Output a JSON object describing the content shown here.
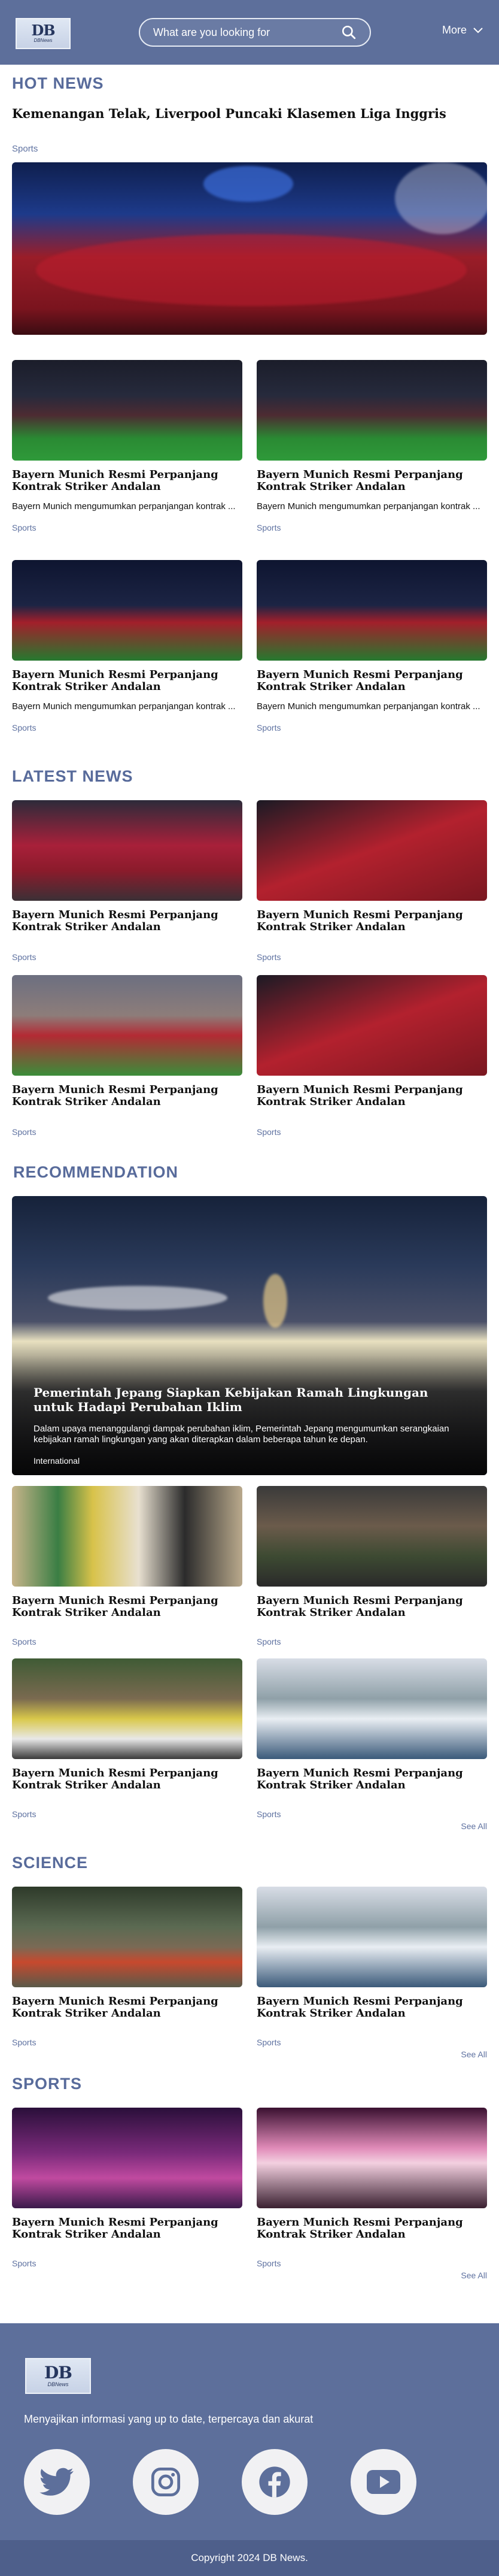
{
  "header": {
    "logo_text": "DB",
    "logo_sub": "DBNews",
    "search_placeholder": "What are you looking for",
    "more_label": "More"
  },
  "hot_news": {
    "section_title": "HOT NEWS",
    "headline": "Kemenangan Telak, Liverpool Puncaki Klasemen Liga Inggris",
    "category": "Sports",
    "cards": [
      {
        "title": "Bayern Munich Resmi Perpanjang Kontrak Striker Andalan",
        "desc": "Bayern Munich mengumumkan perpanjangan kontrak ...",
        "category": "Sports"
      },
      {
        "title": "Bayern Munich Resmi Perpanjang Kontrak Striker Andalan",
        "desc": "Bayern Munich mengumumkan perpanjangan kontrak ...",
        "category": "Sports"
      },
      {
        "title": "Bayern Munich Resmi Perpanjang Kontrak Striker Andalan",
        "desc": "Bayern Munich mengumumkan perpanjangan kontrak ...",
        "category": "Sports"
      },
      {
        "title": "Bayern Munich Resmi Perpanjang Kontrak Striker Andalan",
        "desc": "Bayern Munich mengumumkan perpanjangan kontrak ...",
        "category": "Sports"
      }
    ]
  },
  "latest_news": {
    "section_title": "LATEST NEWS",
    "cards": [
      {
        "title": "Bayern Munich Resmi Perpanjang Kontrak Striker Andalan",
        "category": "Sports"
      },
      {
        "title": "Bayern Munich Resmi Perpanjang Kontrak Striker Andalan",
        "category": "Sports"
      },
      {
        "title": "Bayern Munich Resmi Perpanjang Kontrak Striker Andalan",
        "category": "Sports"
      },
      {
        "title": "Bayern Munich Resmi Perpanjang Kontrak Striker Andalan",
        "category": "Sports"
      }
    ]
  },
  "recommendation": {
    "section_title": "RECOMMENDATION",
    "hero": {
      "title": "Pemerintah Jepang Siapkan Kebijakan Ramah Lingkungan untuk Hadapi Perubahan Iklim",
      "desc": "Dalam upaya menanggulangi dampak perubahan iklim, Pemerintah Jepang mengumumkan serangkaian kebijakan ramah lingkungan yang akan diterapkan dalam beberapa tahun ke depan.",
      "category": "International"
    },
    "cards": [
      {
        "title": "Bayern Munich Resmi Perpanjang Kontrak Striker Andalan",
        "category": "Sports"
      },
      {
        "title": "Bayern Munich Resmi Perpanjang Kontrak Striker Andalan",
        "category": "Sports"
      },
      {
        "title": "Bayern Munich Resmi Perpanjang Kontrak Striker Andalan",
        "category": "Sports"
      },
      {
        "title": "Bayern Munich Resmi Perpanjang Kontrak Striker Andalan",
        "category": "Sports"
      }
    ],
    "see_all": "See All"
  },
  "science": {
    "section_title": "SCIENCE",
    "cards": [
      {
        "title": "Bayern Munich Resmi Perpanjang Kontrak Striker Andalan",
        "category": "Sports"
      },
      {
        "title": "Bayern Munich Resmi Perpanjang Kontrak Striker Andalan",
        "category": "Sports"
      }
    ],
    "see_all": "See All"
  },
  "sports": {
    "section_title": "SPORTS",
    "cards": [
      {
        "title": "Bayern Munich Resmi Perpanjang Kontrak Striker Andalan",
        "category": "Sports"
      },
      {
        "title": "Bayern Munich Resmi Perpanjang Kontrak Striker Andalan",
        "category": "Sports"
      }
    ],
    "see_all": "See All"
  },
  "footer": {
    "logo_text": "DB",
    "logo_sub": "DBNews",
    "tagline": "Menyajikan informasi yang up to date, terpercaya dan akurat",
    "social": [
      "twitter-icon",
      "instagram-icon",
      "facebook-icon",
      "youtube-icon"
    ],
    "copyright": "Copyright 2024 DB News."
  },
  "colors": {
    "brand": "#5d6f9b",
    "accent_text": "#586b9b",
    "footer_bottom": "#4e5f8b"
  }
}
